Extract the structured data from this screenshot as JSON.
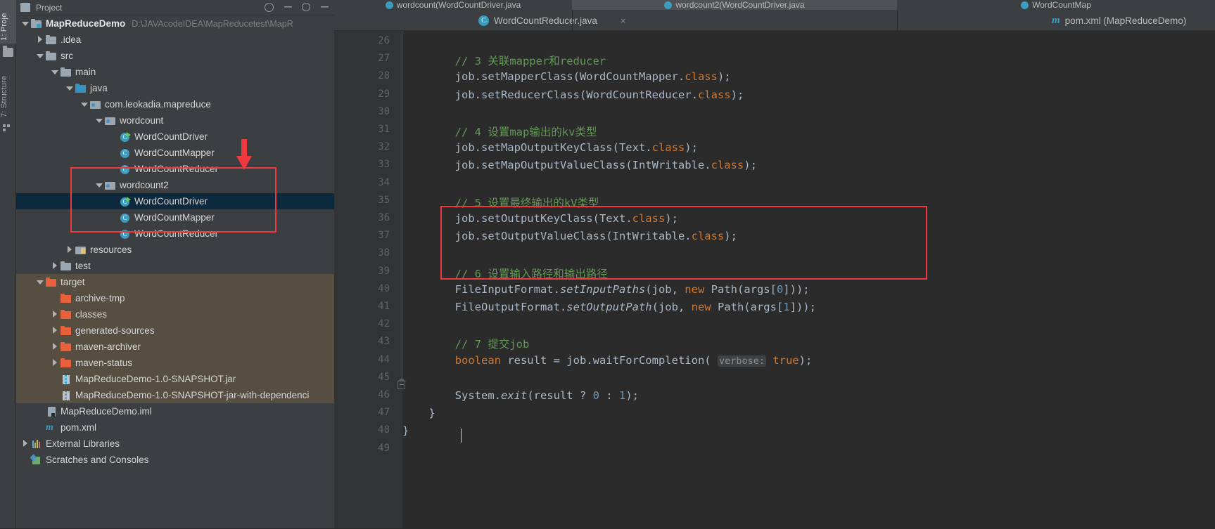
{
  "toolwindows": {
    "project_tab": "1: Proje",
    "structure_tab": "7: Structure",
    "folder_icon": "folder-icon",
    "structure_icon": "structure-icon"
  },
  "project_panel": {
    "header_title": "Project",
    "tree": [
      {
        "indent": 0,
        "arrow": "down",
        "icon": "module-icon",
        "label": "MapReduceDemo",
        "path": "D:\\JAVAcodeIDEA\\MapReducetest\\MapR",
        "bold": true
      },
      {
        "indent": 1,
        "arrow": "right",
        "icon": "folder-icon",
        "label": ".idea"
      },
      {
        "indent": 1,
        "arrow": "down",
        "icon": "folder-icon",
        "label": "src"
      },
      {
        "indent": 2,
        "arrow": "down",
        "icon": "folder-icon",
        "label": "main"
      },
      {
        "indent": 3,
        "arrow": "down",
        "icon": "source-folder-icon",
        "label": "java"
      },
      {
        "indent": 4,
        "arrow": "down",
        "icon": "package-icon",
        "label": "com.leokadia.mapreduce"
      },
      {
        "indent": 5,
        "arrow": "down",
        "icon": "package-icon",
        "label": "wordcount"
      },
      {
        "indent": 6,
        "arrow": "none",
        "icon": "java-class-runnable-icon",
        "label": "WordCountDriver"
      },
      {
        "indent": 6,
        "arrow": "none",
        "icon": "java-class-icon",
        "label": "WordCountMapper"
      },
      {
        "indent": 6,
        "arrow": "none",
        "icon": "java-class-icon",
        "label": "WordCountReducer"
      },
      {
        "indent": 5,
        "arrow": "down",
        "icon": "package-icon",
        "label": "wordcount2"
      },
      {
        "indent": 6,
        "arrow": "none",
        "icon": "java-class-runnable-icon",
        "label": "WordCountDriver",
        "selected": true
      },
      {
        "indent": 6,
        "arrow": "none",
        "icon": "java-class-icon",
        "label": "WordCountMapper"
      },
      {
        "indent": 6,
        "arrow": "none",
        "icon": "java-class-icon",
        "label": "WordCountReducer"
      },
      {
        "indent": 3,
        "arrow": "right",
        "icon": "resources-folder-icon",
        "label": "resources"
      },
      {
        "indent": 2,
        "arrow": "right",
        "icon": "folder-icon",
        "label": "test"
      },
      {
        "indent": 1,
        "arrow": "down",
        "icon": "excluded-folder-icon",
        "label": "target",
        "excluded": true
      },
      {
        "indent": 2,
        "arrow": "none",
        "icon": "excluded-folder-icon",
        "label": "archive-tmp",
        "excluded": true
      },
      {
        "indent": 2,
        "arrow": "right",
        "icon": "excluded-folder-icon",
        "label": "classes",
        "excluded": true
      },
      {
        "indent": 2,
        "arrow": "right",
        "icon": "excluded-folder-icon",
        "label": "generated-sources",
        "excluded": true
      },
      {
        "indent": 2,
        "arrow": "right",
        "icon": "excluded-folder-icon",
        "label": "maven-archiver",
        "excluded": true
      },
      {
        "indent": 2,
        "arrow": "right",
        "icon": "excluded-folder-icon",
        "label": "maven-status",
        "excluded": true
      },
      {
        "indent": 2,
        "arrow": "none",
        "icon": "jar-icon",
        "label": "MapReduceDemo-1.0-SNAPSHOT.jar",
        "excluded": true
      },
      {
        "indent": 2,
        "arrow": "none",
        "icon": "jar-icon",
        "label": "MapReduceDemo-1.0-SNAPSHOT-jar-with-dependenci",
        "excluded": true
      },
      {
        "indent": 1,
        "arrow": "none",
        "icon": "iml-file-icon",
        "label": "MapReduceDemo.iml"
      },
      {
        "indent": 1,
        "arrow": "none",
        "icon": "maven-pom-icon",
        "label": "pom.xml"
      },
      {
        "indent": 0,
        "arrow": "right",
        "icon": "libraries-icon",
        "label": "External Libraries"
      },
      {
        "indent": 0,
        "arrow": "none",
        "icon": "scratches-icon",
        "label": "Scratches and Consoles"
      }
    ]
  },
  "editor": {
    "tabs_row1": [
      {
        "label": "wordcount(WordCountDriver.java",
        "icon": "java-class-icon",
        "active": false
      },
      {
        "label": "wordcount2(WordCountDriver.java",
        "icon": "java-class-icon",
        "active": true
      },
      {
        "label": "WordCountMap",
        "icon": "java-class-icon",
        "active": false
      }
    ],
    "tabs_row2": [
      {
        "label": "WordCountReducer.java",
        "icon": "java-class-icon",
        "close": "×"
      },
      {
        "label": "pom.xml (MapReduceDemo)",
        "icon": "maven-pom-icon"
      }
    ],
    "first_line_number": 26,
    "lines": [
      {
        "n": 26,
        "segments": []
      },
      {
        "n": 27,
        "segments": [
          {
            "t": "        // 3 关联mapper和reducer",
            "c": "cmt"
          }
        ]
      },
      {
        "n": 28,
        "segments": [
          {
            "t": "        job.setMapperClass(WordCountMapper."
          },
          {
            "t": "class",
            "c": "kw"
          },
          {
            "t": ");"
          }
        ]
      },
      {
        "n": 29,
        "segments": [
          {
            "t": "        job.setReducerClass(WordCountReducer."
          },
          {
            "t": "class",
            "c": "kw"
          },
          {
            "t": ");"
          }
        ]
      },
      {
        "n": 30,
        "segments": []
      },
      {
        "n": 31,
        "segments": [
          {
            "t": "        // 4 设置map输出的kv类型",
            "c": "cmt"
          }
        ]
      },
      {
        "n": 32,
        "segments": [
          {
            "t": "        job.setMapOutputKeyClass(Text."
          },
          {
            "t": "class",
            "c": "kw"
          },
          {
            "t": ");"
          }
        ]
      },
      {
        "n": 33,
        "segments": [
          {
            "t": "        job.setMapOutputValueClass(IntWritable."
          },
          {
            "t": "class",
            "c": "kw"
          },
          {
            "t": ");"
          }
        ]
      },
      {
        "n": 34,
        "segments": []
      },
      {
        "n": 35,
        "segments": [
          {
            "t": "        // 5 设置最终输出的kV类型",
            "c": "cmt"
          }
        ]
      },
      {
        "n": 36,
        "segments": [
          {
            "t": "        job.setOutputKeyClass(Text."
          },
          {
            "t": "class",
            "c": "kw"
          },
          {
            "t": ");"
          }
        ]
      },
      {
        "n": 37,
        "segments": [
          {
            "t": "        job.setOutputValueClass(IntWritable."
          },
          {
            "t": "class",
            "c": "kw"
          },
          {
            "t": ");"
          }
        ]
      },
      {
        "n": 38,
        "segments": []
      },
      {
        "n": 39,
        "segments": [
          {
            "t": "        // 6 设置输入路径和输出路径",
            "c": "cmt"
          }
        ]
      },
      {
        "n": 40,
        "segments": [
          {
            "t": "        FileInputFormat."
          },
          {
            "t": "setInputPaths",
            "c": "it"
          },
          {
            "t": "(job, "
          },
          {
            "t": "new",
            "c": "kw"
          },
          {
            "t": " Path(args["
          },
          {
            "t": "0",
            "c": "num"
          },
          {
            "t": "]));"
          }
        ]
      },
      {
        "n": 41,
        "segments": [
          {
            "t": "        FileOutputFormat."
          },
          {
            "t": "setOutputPath",
            "c": "it"
          },
          {
            "t": "(job, "
          },
          {
            "t": "new",
            "c": "kw"
          },
          {
            "t": " Path(args["
          },
          {
            "t": "1",
            "c": "num"
          },
          {
            "t": "]));"
          }
        ]
      },
      {
        "n": 42,
        "segments": []
      },
      {
        "n": 43,
        "segments": [
          {
            "t": "        // 7 提交job",
            "c": "cmt"
          }
        ]
      },
      {
        "n": 44,
        "segments": [
          {
            "t": "        "
          },
          {
            "t": "boolean",
            "c": "kw"
          },
          {
            "t": " result = job.waitForCompletion( "
          },
          {
            "t": "verbose:",
            "c": "hint"
          },
          {
            "t": " "
          },
          {
            "t": "true",
            "c": "kw"
          },
          {
            "t": ");"
          }
        ]
      },
      {
        "n": 45,
        "segments": []
      },
      {
        "n": 46,
        "segments": [
          {
            "t": "        System."
          },
          {
            "t": "exit",
            "c": "it"
          },
          {
            "t": "(result ? "
          },
          {
            "t": "0",
            "c": "num"
          },
          {
            "t": " : "
          },
          {
            "t": "1",
            "c": "num"
          },
          {
            "t": ");"
          }
        ]
      },
      {
        "n": 47,
        "segments": [
          {
            "t": "    }"
          }
        ]
      },
      {
        "n": 48,
        "segments": [
          {
            "t": "}"
          }
        ]
      },
      {
        "n": 49,
        "segments": []
      }
    ]
  },
  "annotations": {
    "tree_highlight_box": "red-rectangle-wordcount2",
    "tree_arrow": "red-down-arrow",
    "code_highlight_box": "red-rectangle-file-paths",
    "color": "#f0393e"
  },
  "colors": {
    "panel_bg": "#3c3f41",
    "editor_bg": "#2b2b2b",
    "gutter_bg": "#313335",
    "selection_bg": "#0d293e",
    "excluded_bg": "#564f41",
    "accent_blue": "#4a88c7",
    "comment_green": "#629755",
    "keyword_orange": "#cc7832",
    "number_blue": "#6897bb",
    "text_gray": "#a9b7c6"
  }
}
